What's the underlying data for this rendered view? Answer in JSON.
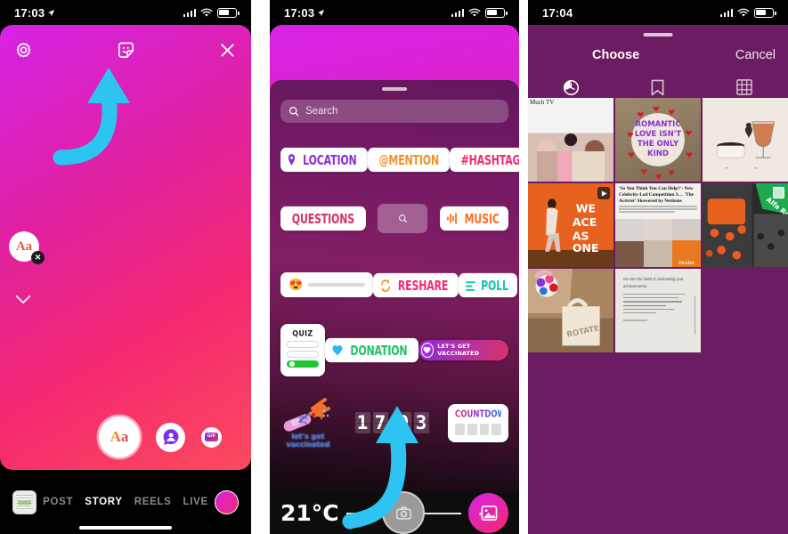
{
  "panel1": {
    "status": {
      "time": "17:03",
      "location_arrow": "➤"
    },
    "header": {
      "settings_icon": "settings-gear-icon",
      "sticker_icon": "sticker-face-icon",
      "close_icon": "close-x-icon"
    },
    "annotation": {
      "arrow": "curved-up-arrow",
      "color": "#2ec4f1"
    },
    "text_chip": {
      "label": "Aa",
      "remove": "✕"
    },
    "chevron": "chevron-down-icon",
    "tools": {
      "text_tool": "Aa",
      "sticker_tool": "avatar-sticker-icon",
      "gif_tool": "GIF"
    },
    "modebar": {
      "gallery_thumb": "gallery-thumbnail",
      "modes": [
        "POST",
        "STORY",
        "REELS",
        "LIVE"
      ],
      "active_mode": "STORY",
      "shutter": "shutter-dot"
    }
  },
  "panel2": {
    "status": {
      "time": "17:03",
      "location_arrow": "➤"
    },
    "search": {
      "placeholder": "Search",
      "icon": "search-icon"
    },
    "stickers": {
      "row1": [
        {
          "label": "LOCATION",
          "icon": "pin-icon",
          "color": "#8b2fd6"
        },
        {
          "label": "@MENTION",
          "icon": "at-icon",
          "color": "#f0932b"
        },
        {
          "label": "#HASHTAG",
          "icon": "hash-icon",
          "color": "#f5296f"
        }
      ],
      "row2": [
        {
          "label": "QUESTIONS",
          "color": "#d6336c"
        },
        {
          "label": "",
          "type": "placeholder-tile",
          "icon": "search-icon"
        },
        {
          "label": "MUSIC",
          "icon": "music-bars-icon",
          "color": "#f5702a"
        }
      ],
      "row3": [
        {
          "label": "",
          "type": "emoji-slider",
          "emoji": "😍"
        },
        {
          "label": "RESHARE",
          "icon": "reshare-icon",
          "color": "#f5296f"
        },
        {
          "label": "POLL",
          "icon": "poll-lines-icon",
          "color": "#17c3b2"
        }
      ],
      "row4": [
        {
          "label": "QUIZ",
          "type": "quiz",
          "options": [
            "",
            "",
            "correct"
          ]
        },
        {
          "label": "DONATION",
          "icon": "heart-icon",
          "color": "#1fc16b"
        },
        {
          "label": "LET'S GET VACCINATED",
          "type": "vaccinated-badge"
        }
      ],
      "row5": [
        {
          "label": "let's get vaccinated",
          "type": "vaccine-illustration"
        },
        {
          "label": "17 03",
          "type": "time",
          "digits": [
            "1",
            "7",
            "0",
            "3"
          ]
        },
        {
          "label": "COUNTDOWN",
          "type": "countdown",
          "boxes": 4
        }
      ]
    },
    "annotation": {
      "arrow": "curved-up-arrow",
      "color": "#2ec4f1"
    },
    "bottom": {
      "temperature": "21°C",
      "shutter": "camera-shutter-button",
      "gallery": "gallery-picker-button"
    }
  },
  "panel3": {
    "status": {
      "time": "17:04"
    },
    "header": {
      "choose": "Choose",
      "cancel": "Cancel"
    },
    "tabs": [
      {
        "name": "recents-tab",
        "icon": "recents-icon"
      },
      {
        "name": "saved-tab",
        "icon": "bookmark-icon"
      },
      {
        "name": "grid-tab",
        "icon": "grid-icon"
      }
    ],
    "photos": [
      {
        "id": "much-tv",
        "caption": "Much TV",
        "art": "art-muchtv",
        "mark": ""
      },
      {
        "id": "romantic-cake",
        "caption": "",
        "art": "art-cake",
        "text": "ROMANTIC LOVE ISN'T THE ONLY KIND",
        "mark": ""
      },
      {
        "id": "wine-glass",
        "caption": "",
        "art": "art-wine",
        "mark": ""
      },
      {
        "id": "we-ace-as-one",
        "caption": "",
        "art": "art-weaceasone",
        "text": "WE ACE AS ONE",
        "mark": "reel"
      },
      {
        "id": "news-article",
        "caption": "'So You Think You Can Help?': New Celebrity-Led Competition S… 'The Activist' Skewered by Netizens",
        "art": "art-news",
        "mark": ""
      },
      {
        "id": "f1-pitstop",
        "caption": "",
        "art": "art-f1",
        "mark": "check"
      },
      {
        "id": "rotate-tote",
        "caption": "ROTATE",
        "art": "art-tote",
        "mark": ""
      },
      {
        "id": "quote-card",
        "caption": "Get into the habit of celebrating your achievements.",
        "art": "art-quote",
        "mark": ""
      }
    ]
  }
}
